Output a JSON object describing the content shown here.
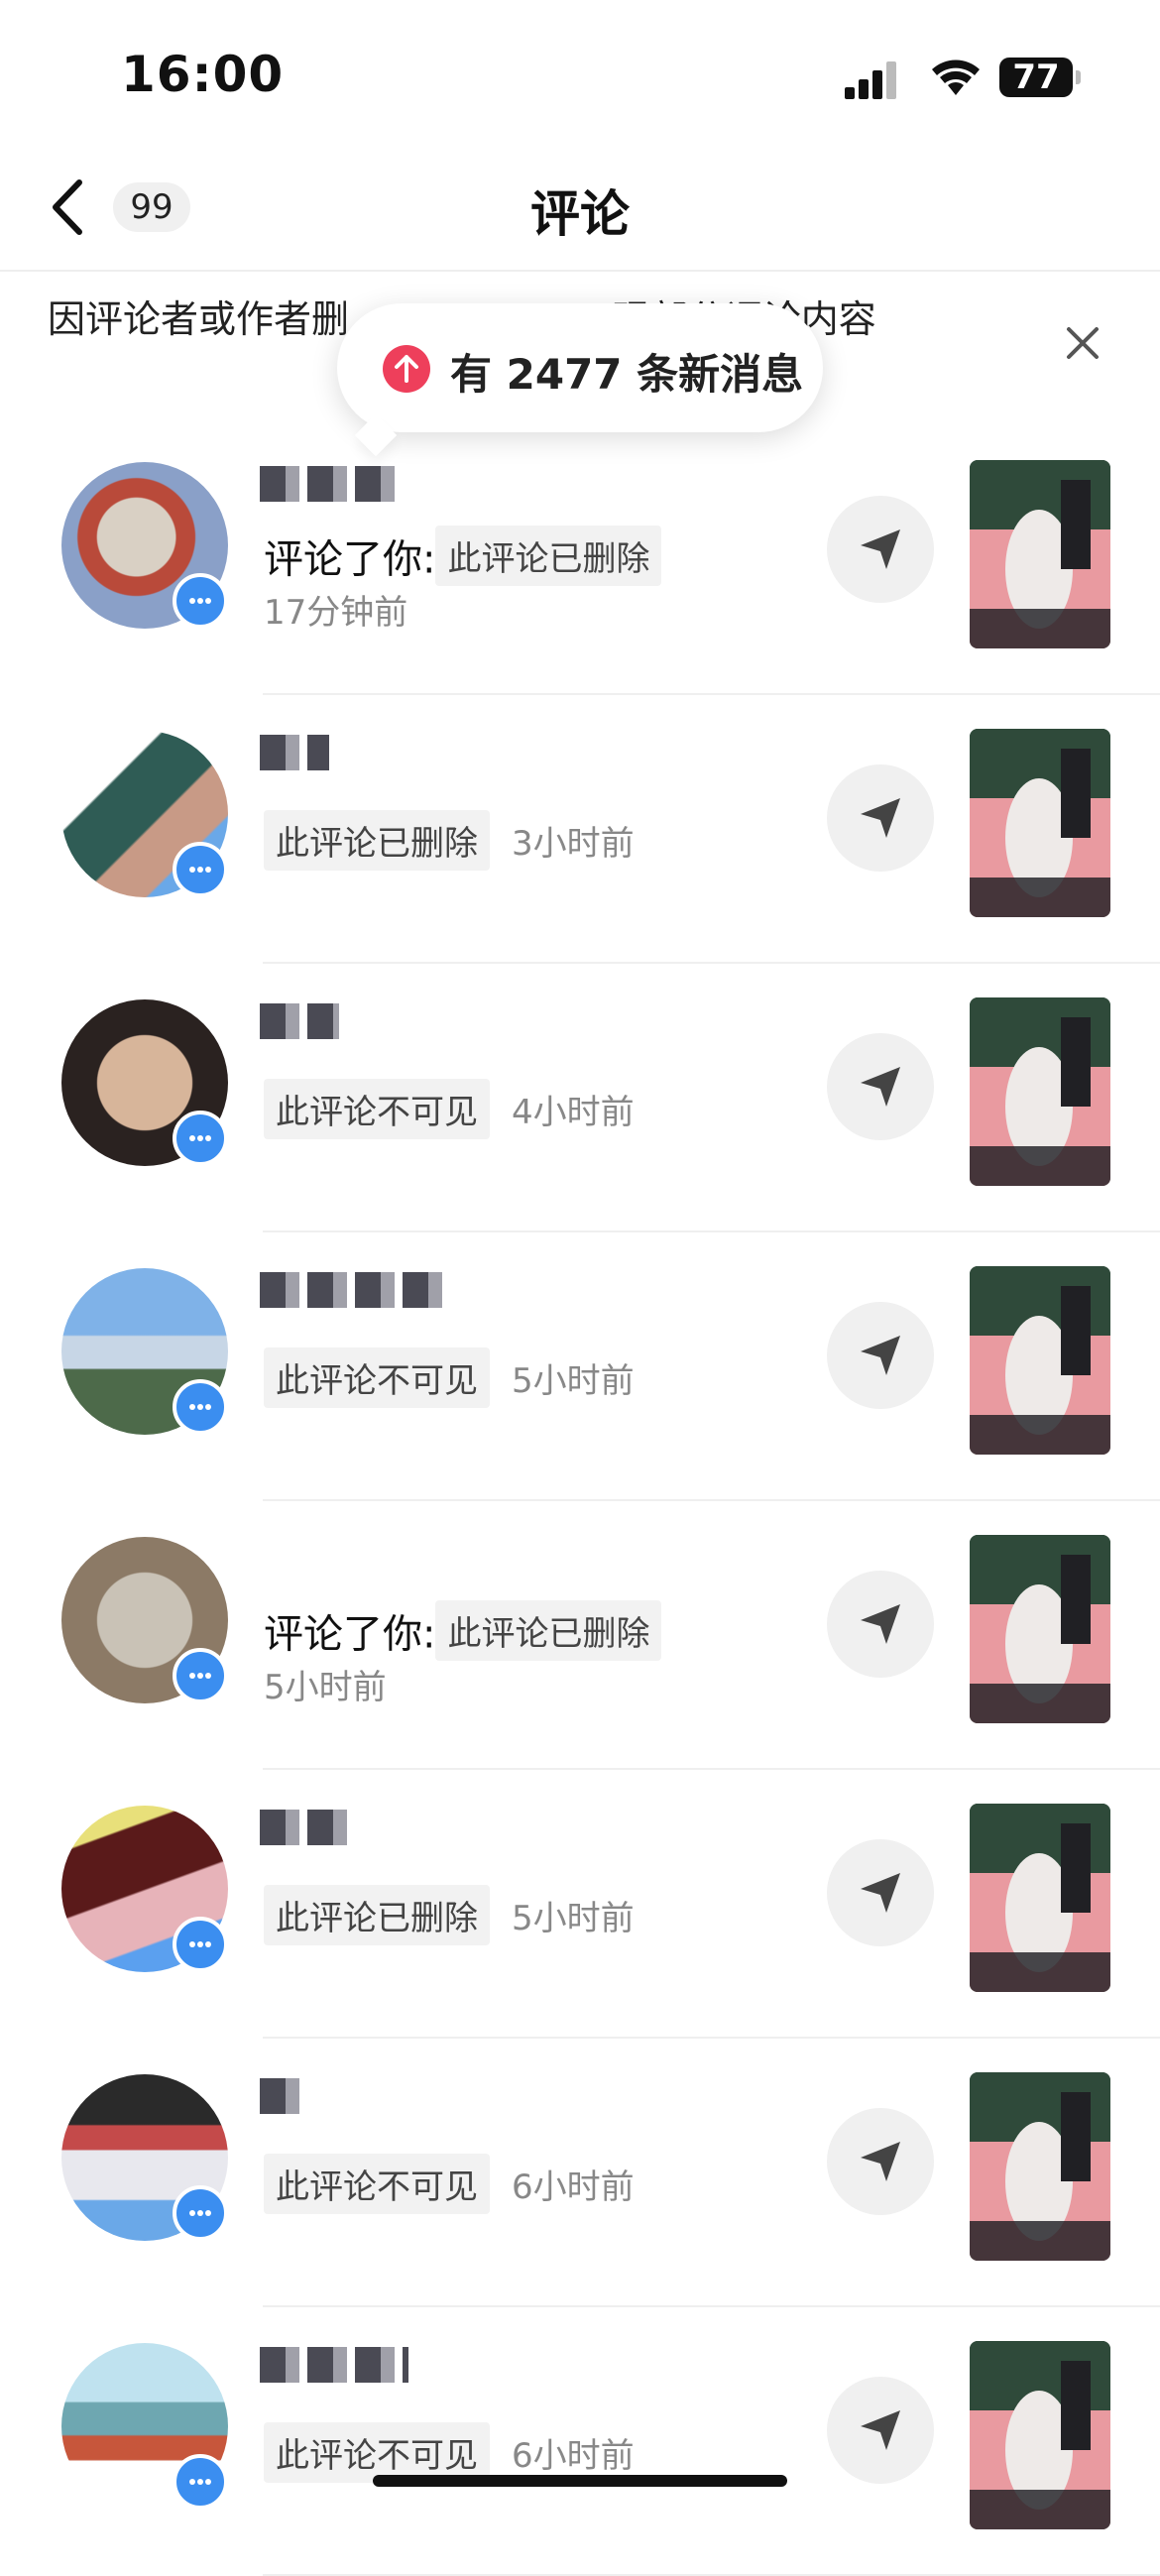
{
  "status_bar": {
    "time": "16:00",
    "battery": "77"
  },
  "nav": {
    "title": "评论",
    "badge": "99"
  },
  "notice": {
    "text": "因评论者或作者删除…………现部分评论内容",
    "text_visible": "因评论者或作者删                      现部分评论内容"
  },
  "toast": {
    "text": "有 2477 条新消息"
  },
  "items": [
    {
      "prefix": "评论了你:",
      "chip": "此评论已删除",
      "time": "17分钟前"
    },
    {
      "prefix": "",
      "chip": "此评论已删除",
      "time": "3小时前"
    },
    {
      "prefix": "",
      "chip": "此评论不可见",
      "time": "4小时前"
    },
    {
      "prefix": "",
      "chip": "此评论不可见",
      "time": "5小时前"
    },
    {
      "prefix": "评论了你:",
      "chip": "此评论已删除",
      "time": "5小时前"
    },
    {
      "prefix": "",
      "chip": "此评论已删除",
      "time": "5小时前"
    },
    {
      "prefix": "",
      "chip": "此评论不可见",
      "time": "6小时前"
    },
    {
      "prefix": "",
      "chip": "此评论不可见",
      "time": "6小时前"
    }
  ],
  "icons": {
    "back": "chevron-left-icon",
    "close": "close-icon",
    "reply": "send-icon",
    "toast": "arrow-up-icon"
  },
  "colors": {
    "toast_icon": "#ee3f5b",
    "badge_blue": "#3b8ef0"
  }
}
